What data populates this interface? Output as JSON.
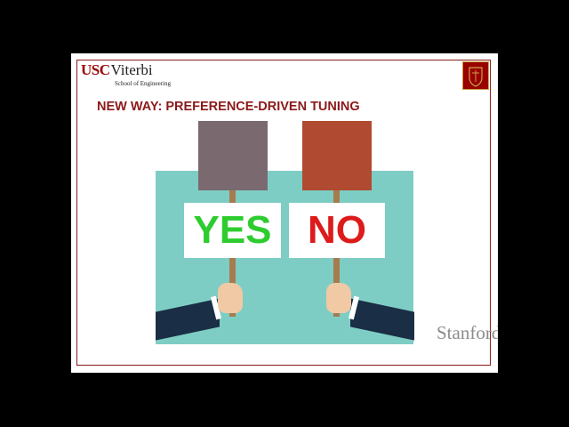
{
  "slide": {
    "title": "NEW WAY: PREFERENCE-DRIVEN TUNING",
    "header_logo": {
      "usc": "USC",
      "viterbi": "Viterbi",
      "subtitle": "School of Engineering"
    },
    "watermark": "Stanford",
    "signs": {
      "yes_label": "YES",
      "no_label": "NO"
    },
    "colors": {
      "frame_border": "#8b1a1a",
      "title": "#8b1a1a",
      "teal_panel": "#7ecdc4",
      "yes": "#2ecc2e",
      "no": "#dd1b1b",
      "square_grey": "#7a6a70",
      "square_red": "#b04a30",
      "sleeve": "#1a2e45"
    }
  }
}
